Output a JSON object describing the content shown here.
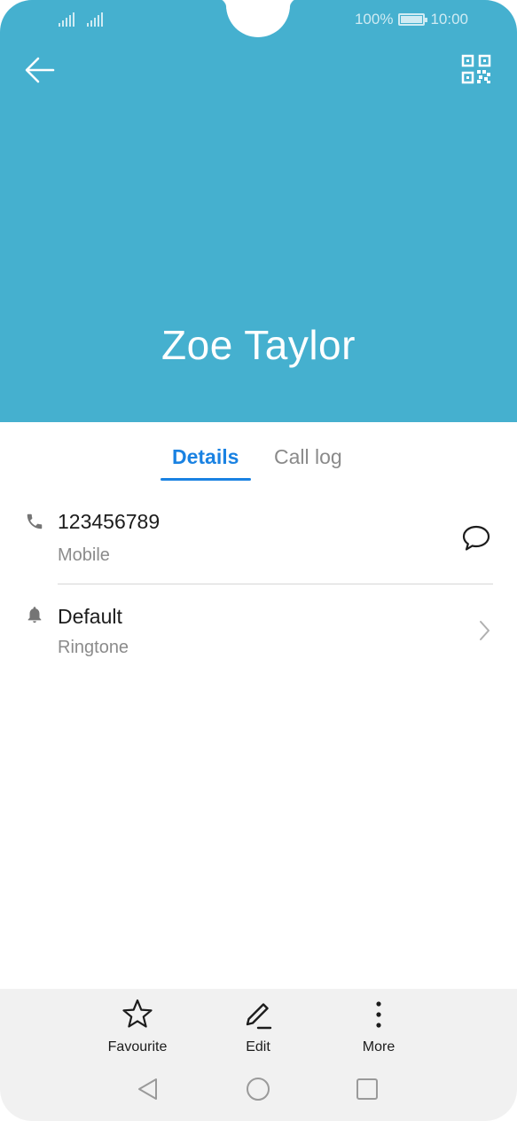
{
  "status_bar": {
    "battery": "100%",
    "time": "10:00",
    "signal_icons": [
      "signal-icon",
      "signal-icon"
    ]
  },
  "header": {
    "contact_name": "Zoe Taylor",
    "back_icon": "back-arrow-icon",
    "qr_icon": "qr-code-icon",
    "background": "#45b0cf"
  },
  "tabs": [
    {
      "label": "Details",
      "active": true
    },
    {
      "label": "Call log",
      "active": false
    }
  ],
  "details": {
    "phone": {
      "number": "123456789",
      "type": "Mobile",
      "icon": "phone-icon",
      "action_icon": "message-icon"
    },
    "ringtone": {
      "value": "Default",
      "label": "Ringtone",
      "icon": "bell-icon",
      "action_icon": "chevron-right-icon"
    }
  },
  "actions": [
    {
      "label": "Favourite",
      "icon": "star-icon"
    },
    {
      "label": "Edit",
      "icon": "pencil-icon"
    },
    {
      "label": "More",
      "icon": "more-vertical-icon"
    }
  ],
  "nav_bar": [
    "back-triangle-icon",
    "home-circle-icon",
    "recents-square-icon"
  ],
  "colors": {
    "accent": "#1a82e2",
    "header": "#45b0cf",
    "bottom_bar": "#f1f1f1"
  }
}
